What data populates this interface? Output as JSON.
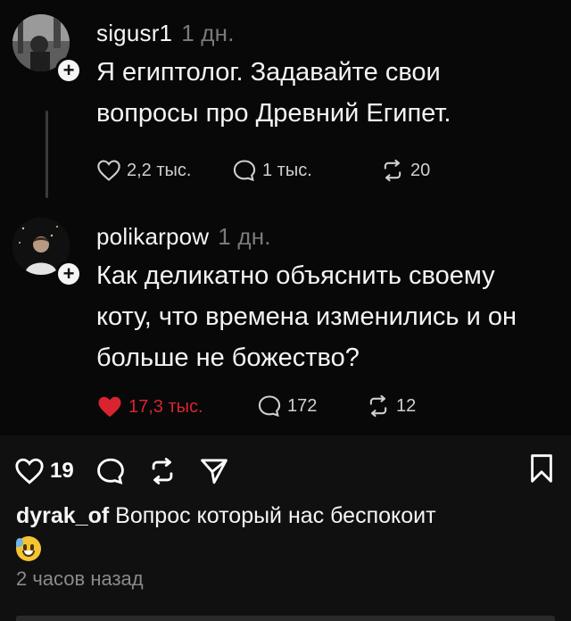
{
  "thread": {
    "posts": [
      {
        "username": "sigusr1",
        "time": "1 дн.",
        "text_lines": [
          "Я египтолог. Задавайте свои",
          "вопросы про Древний Египет."
        ],
        "likes": "2,2 тыс.",
        "comments": "1 тыс.",
        "reposts": "20",
        "liked": false
      },
      {
        "username": "polikarpow",
        "time": "1 дн.",
        "text_lines": [
          "Как деликатно объяснить своему",
          "коту, что времена изменились и он",
          "больше не божество?"
        ],
        "likes": "17,3 тыс.",
        "comments": "172",
        "reposts": "12",
        "liked": true
      }
    ]
  },
  "footer": {
    "like_count": "19",
    "caption_author": "dyrak_of",
    "caption_text": "Вопрос который нас беспокоит",
    "caption_emoji": "grinning-sweat-emoji",
    "time_ago": "2 часов назад"
  },
  "colors": {
    "background": "#080808",
    "footer_background": "#101010",
    "like_red": "#d8242f",
    "muted_text": "#7a7a7a"
  }
}
